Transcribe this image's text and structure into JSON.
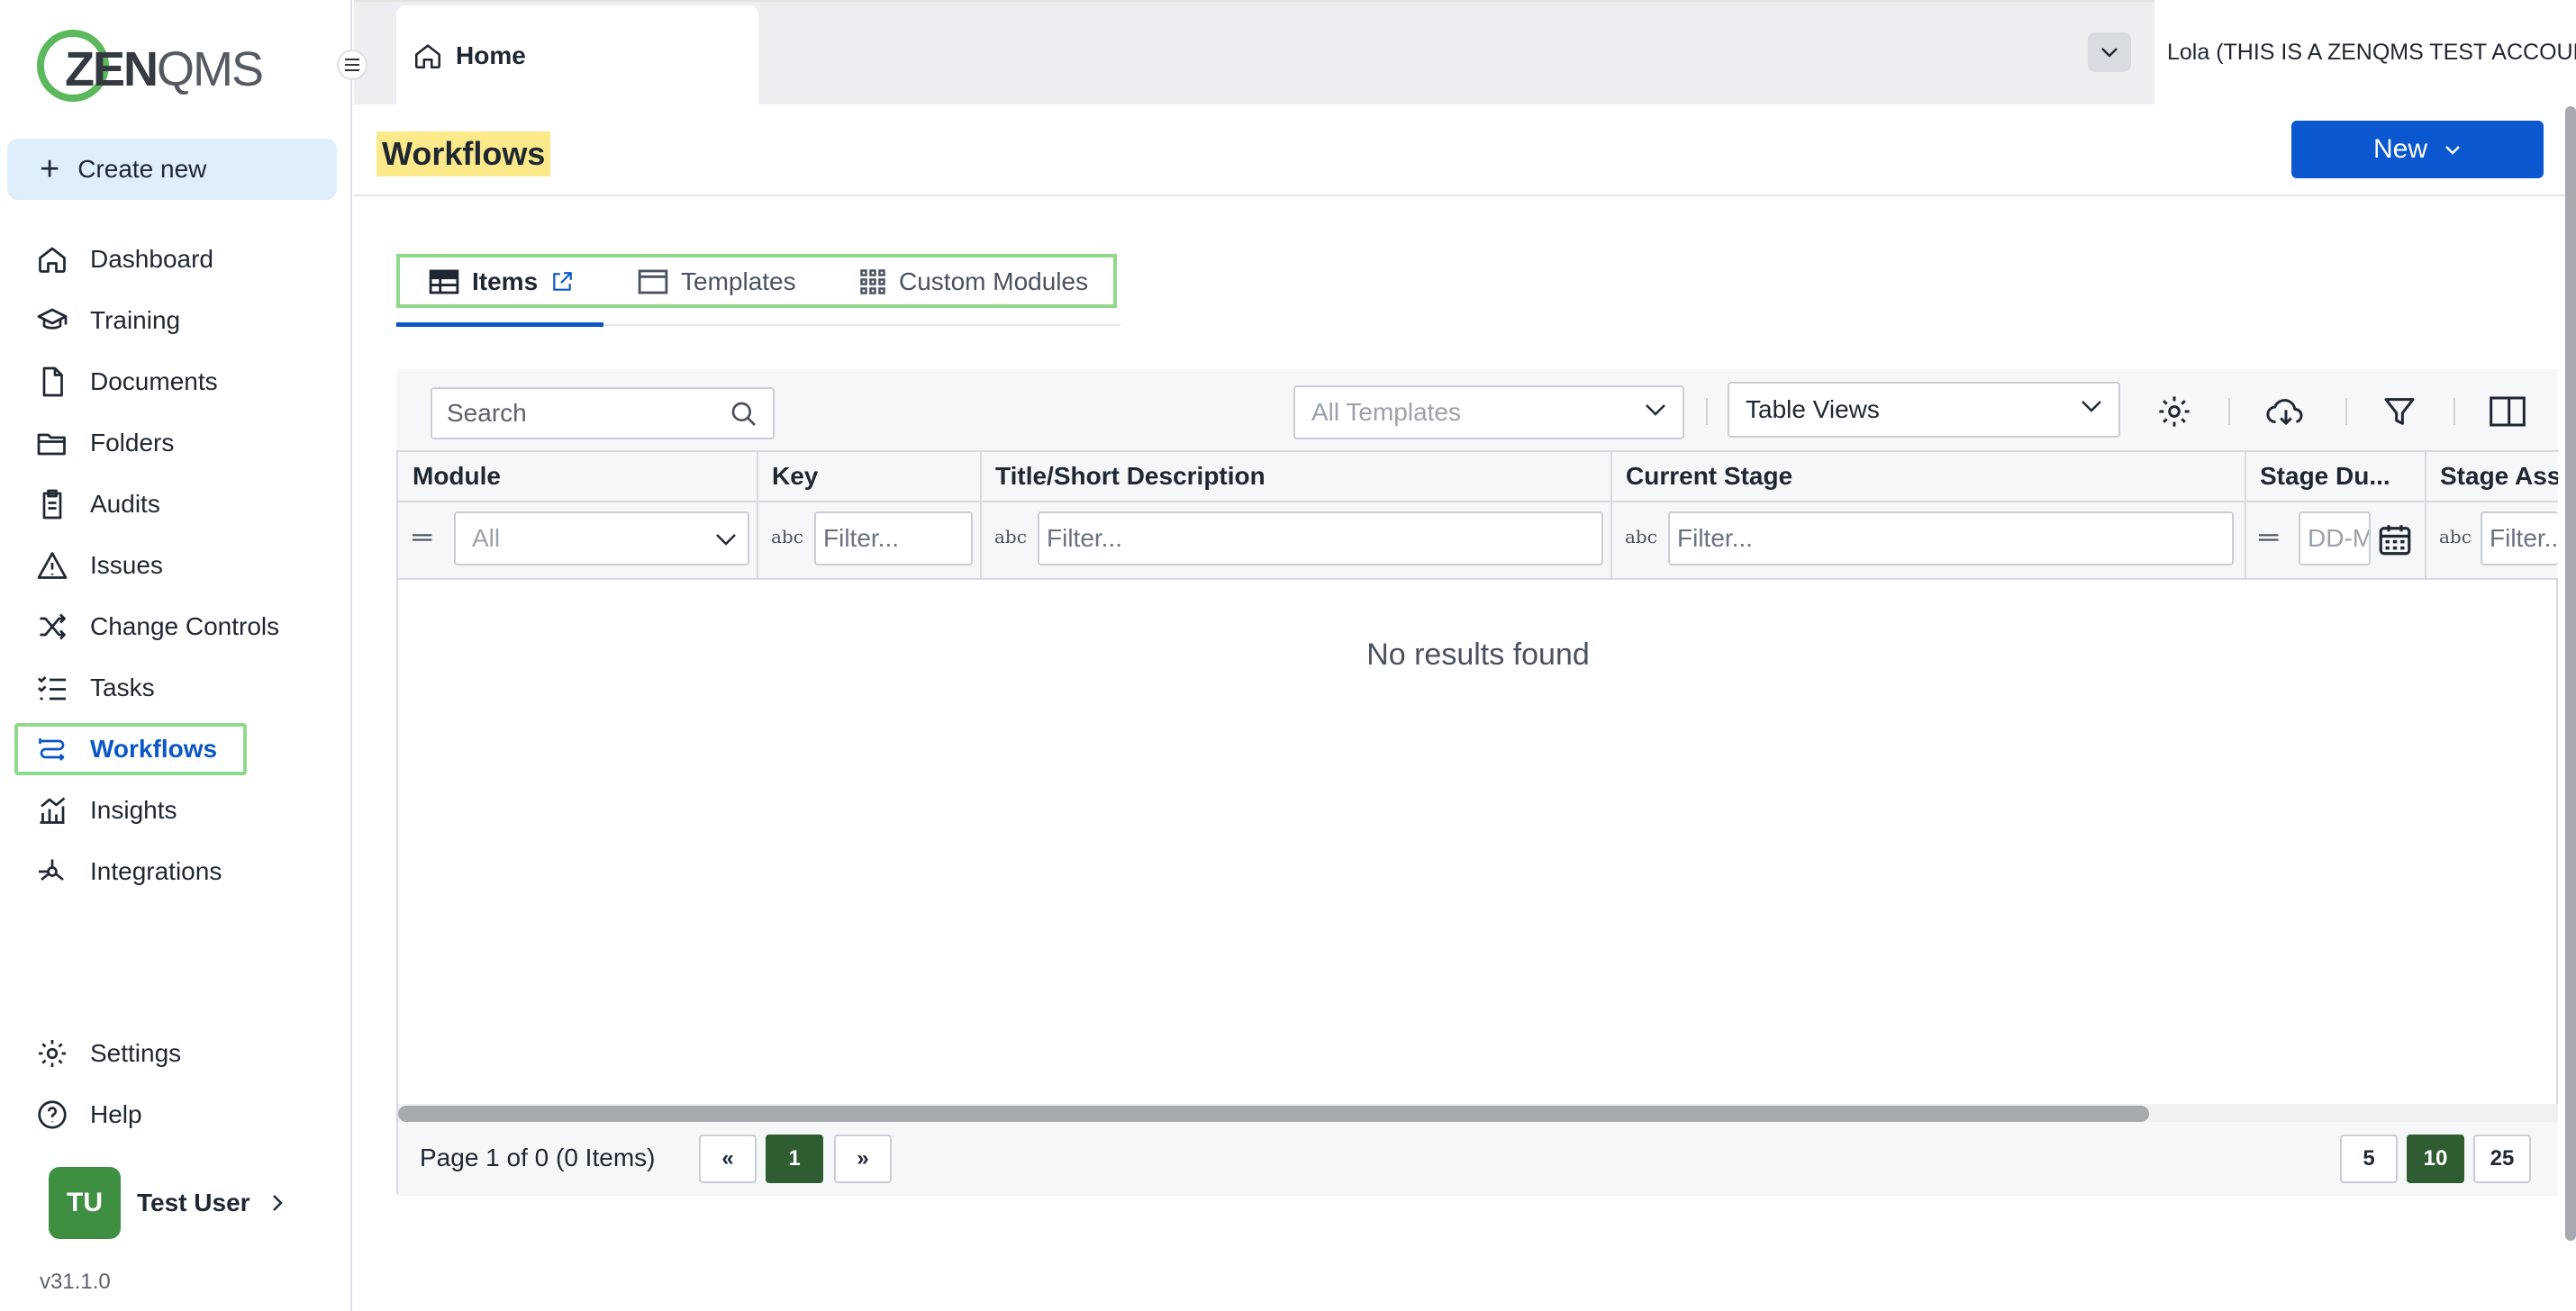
{
  "app": {
    "logo_text_bold": "ZEN",
    "logo_text_light": "QMS",
    "version": "v31.1.0"
  },
  "sidebar": {
    "create_new": "Create new",
    "items": [
      {
        "label": "Dashboard",
        "icon": "home-icon"
      },
      {
        "label": "Training",
        "icon": "graduation-cap-icon"
      },
      {
        "label": "Documents",
        "icon": "document-icon"
      },
      {
        "label": "Folders",
        "icon": "folder-icon"
      },
      {
        "label": "Audits",
        "icon": "clipboard-icon"
      },
      {
        "label": "Issues",
        "icon": "warning-icon"
      },
      {
        "label": "Change Controls",
        "icon": "shuffle-icon"
      },
      {
        "label": "Tasks",
        "icon": "checklist-icon"
      },
      {
        "label": "Workflows",
        "icon": "workflow-icon",
        "active": true
      },
      {
        "label": "Insights",
        "icon": "chart-icon"
      },
      {
        "label": "Integrations",
        "icon": "hub-icon"
      }
    ],
    "settings": "Settings",
    "help": "Help",
    "user": {
      "initials": "TU",
      "name": "Test User"
    }
  },
  "topbar": {
    "home_tab": "Home",
    "account": "Lola (THIS IS A ZENQMS TEST ACCOUNT)"
  },
  "page": {
    "title": "Workflows",
    "new_button": "New"
  },
  "tabs": [
    {
      "label": "Items",
      "active": true
    },
    {
      "label": "Templates",
      "active": false
    },
    {
      "label": "Custom Modules",
      "active": false
    }
  ],
  "grid": {
    "search_placeholder": "Search",
    "templates_dropdown": "All Templates",
    "views_dropdown": "Table Views",
    "columns": [
      "Module",
      "Key",
      "Title/Short Description",
      "Current Stage",
      "Stage Du...",
      "Stage Assi"
    ],
    "module_filter": "All",
    "filter_placeholder": "Filter...",
    "date_placeholder": "DD-M",
    "empty_message": "No results found",
    "page_info": "Page 1 of 0 (0 Items)",
    "pager": {
      "first": "«",
      "current": "1",
      "next": "»"
    },
    "page_sizes": [
      "5",
      "10",
      "25"
    ],
    "active_page_size": "10"
  },
  "colors": {
    "primary": "#0b57d0",
    "highlight": "#fbe98a",
    "annotation_green": "#8fd98a",
    "active_page": "#2f5d31"
  }
}
